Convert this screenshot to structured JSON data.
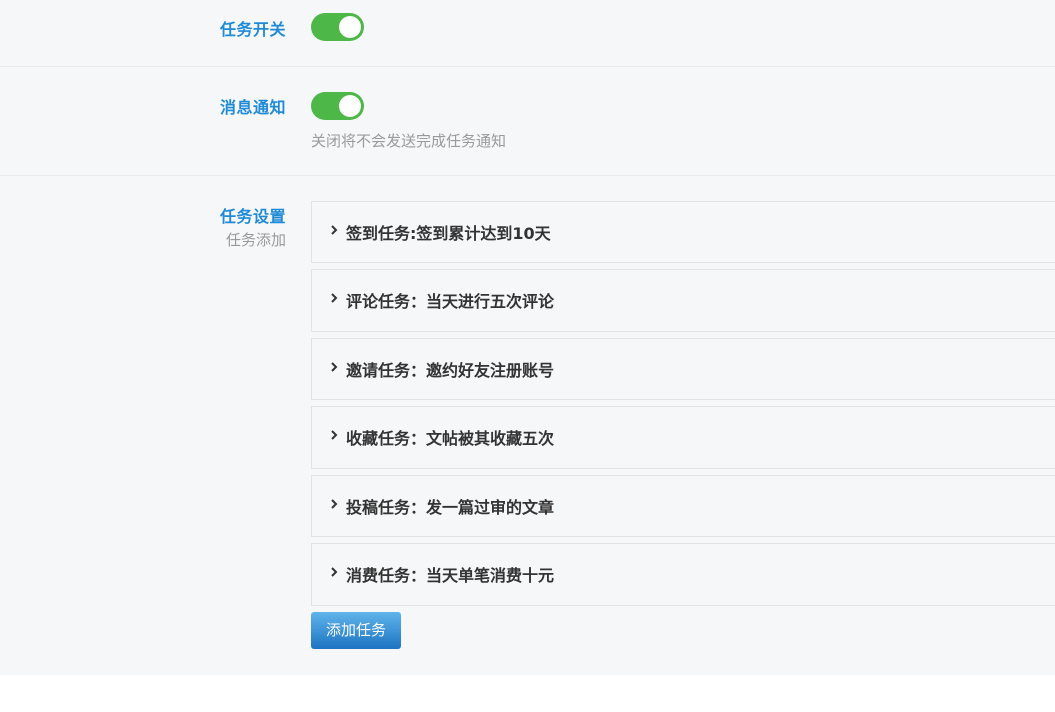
{
  "settings": {
    "task_switch": {
      "label": "任务开关",
      "enabled": true
    },
    "message_notify": {
      "label": "消息通知",
      "enabled": true,
      "hint": "关闭将不会发送完成任务通知"
    },
    "task_settings": {
      "label": "任务设置",
      "sublabel": "任务添加",
      "items": [
        {
          "text": "签到任务:签到累计达到10天"
        },
        {
          "text": "评论任务：当天进行五次评论"
        },
        {
          "text": "邀请任务：邀约好友注册账号"
        },
        {
          "text": " 收藏任务：文帖被其收藏五次"
        },
        {
          "text": "投稿任务：发一篇过审的文章"
        },
        {
          "text": " 消费任务：当天单笔消费十元"
        }
      ],
      "add_button": "添加任务"
    }
  },
  "colors": {
    "accent_label": "#1f8ad6",
    "toggle_on": "#4db848",
    "button_top": "#5fb4ea",
    "button_bottom": "#1d74c2"
  },
  "icons": {
    "item_expand": "chevron-right-icon"
  }
}
